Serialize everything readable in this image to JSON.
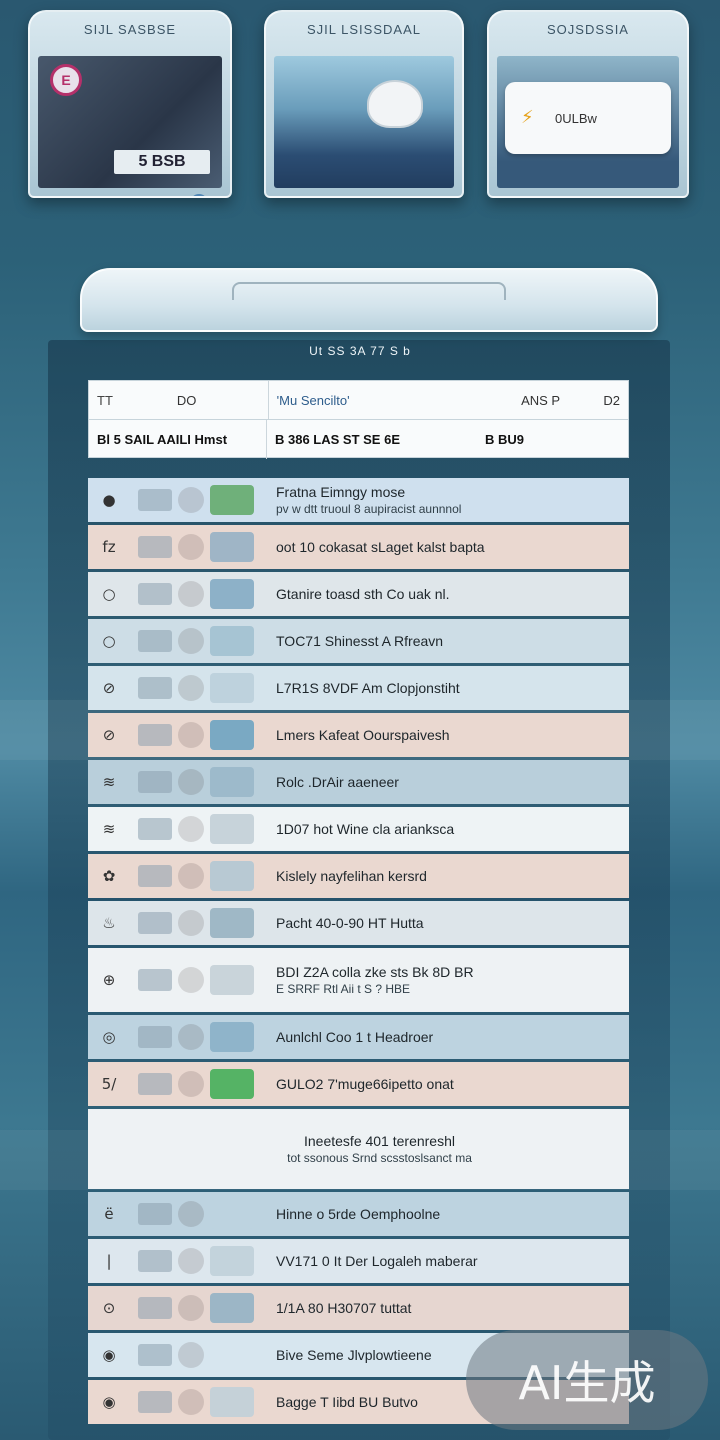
{
  "cards": [
    {
      "title": "SIJL SASBSE",
      "price": "5 BSB"
    },
    {
      "title": "SJIL LSISSDAAL",
      "price": ""
    },
    {
      "title": "SOJSDSSIA",
      "bubble_text": "0ULBw"
    }
  ],
  "caption": "Ut SS 3A 77 S b",
  "header": {
    "row1": [
      "TT",
      "DO",
      "'Mu Sencilto'",
      "ANS P",
      "D2"
    ],
    "row2": [
      "Bl 5 SAIL AAILI Hmst",
      "B 386 LAS ST SE 6E",
      "B BU9"
    ]
  },
  "rows": [
    {
      "icon": "●",
      "title": "Fratna Eimngy mose",
      "sub": "pv w dtt truoul 8 aupiracist aunnnol",
      "bg": "#cfe0ee",
      "thumb": "#6fb07a"
    },
    {
      "icon": "fz",
      "title": "oot 10 cokasat sLaget kalst bapta",
      "bg": "#ead8d0",
      "thumb": "#9fb5c6"
    },
    {
      "icon": "○",
      "title": "Gtanire toasd sth Co uak nl.",
      "bg": "#dfe6ea",
      "thumb": "#8db1c8"
    },
    {
      "icon": "○",
      "title": "TOC71 Shinesst A Rfreavn",
      "bg": "#cddde6",
      "thumb": "#a6c4d3"
    },
    {
      "icon": "⊘",
      "title": "L7R1S 8VDF Am Clopjonstiht",
      "bg": "#d5e4ec",
      "thumb": "#bed2dd"
    },
    {
      "icon": "⊘",
      "title": "Lmers Kafeat Oourspaivesh",
      "bg": "#ead8d0",
      "thumb": "#7aa9c3"
    },
    {
      "icon": "≋",
      "title": "Rolc .DrAir aaeneer",
      "bg": "#b9cfdb",
      "thumb": "#9dbacb"
    },
    {
      "icon": "≋",
      "title": "1D07 hot Wine cla arianksca",
      "bg": "#eef3f5",
      "thumb": "#c7d3da"
    },
    {
      "icon": "✿",
      "title": "Kislely nayfelihan kersrd",
      "bg": "#ead8d0",
      "thumb": "#b8c9d3"
    },
    {
      "icon": "♨",
      "title": "Pacht 40-0-90 HT Hutta",
      "bg": "#dde5ea",
      "thumb": "#9fb8c6"
    },
    {
      "icon": "⊕",
      "title": "BDI Z2A colla zke sts Bk 8D BR",
      "sub": "E SRRF Rtl Aii t S ? HBE",
      "bg": "#eef2f4",
      "thumb": "#c9d4da",
      "tall": true
    },
    {
      "icon": "◎",
      "title": "Aunlchl Coo 1 t Headroer",
      "bg": "#bdd3e0",
      "thumb": "#8fb4ca"
    },
    {
      "icon": "5/",
      "title": "GULO2 7'muge66ipetto onat",
      "bg": "#ead8d0",
      "thumb": "#55b365"
    },
    {
      "icon": "",
      "title": "Ineetesfe 401 terenreshl",
      "sub": "tot ssonous Srnd scsstoslsanct ma",
      "bg": "#eef2f4",
      "thumb": "#eef2f4",
      "xtall": true
    },
    {
      "icon": "ё",
      "title": "Hinne o 5rde Oemphoolne",
      "bg": "#bdd3e0",
      "thumb": "#bdd3e0"
    },
    {
      "icon": "|",
      "title": "VV171 0 It Der Logaleh maberar",
      "bg": "#dde7ee",
      "thumb": "#c3d3dc"
    },
    {
      "icon": "⊙",
      "title": "1/1A 80 H30707 tuttat",
      "bg": "#e6d6d0",
      "thumb": "#9cb6c6"
    },
    {
      "icon": "◉",
      "title": "Bive Seme Jlvplowtieene",
      "bg": "#d7e6ef",
      "thumb": "#d7e6ef"
    },
    {
      "icon": "◉",
      "title": "Bagge T Iibd BU Butvo",
      "bg": "#ead8d0",
      "thumb": "#c5d1d8"
    }
  ],
  "watermark": "AI生成"
}
